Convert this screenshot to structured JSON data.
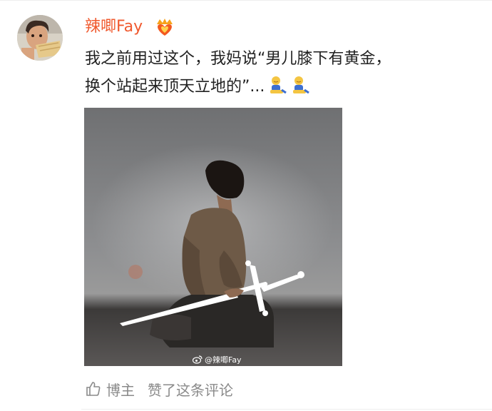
{
  "comment": {
    "username": "辣唧Fay",
    "badge_icon": "crown-heart-icon",
    "text_line_1": "我之前用过这个，我妈说“男儿膝下有黄金，",
    "text_line_2": "换个站起来顶天立地的”...",
    "inline_emojis": [
      "kneeling-person-icon",
      "kneeling-person-icon"
    ],
    "image": {
      "watermark": "@辣唧Fay"
    },
    "footer": {
      "like_icon": "thumbs-up-icon",
      "author_label": "博主",
      "liked_text": "赞了这条评论"
    }
  },
  "colors": {
    "username": "#f0592e",
    "text": "#222222",
    "meta": "#8a8a8a"
  }
}
